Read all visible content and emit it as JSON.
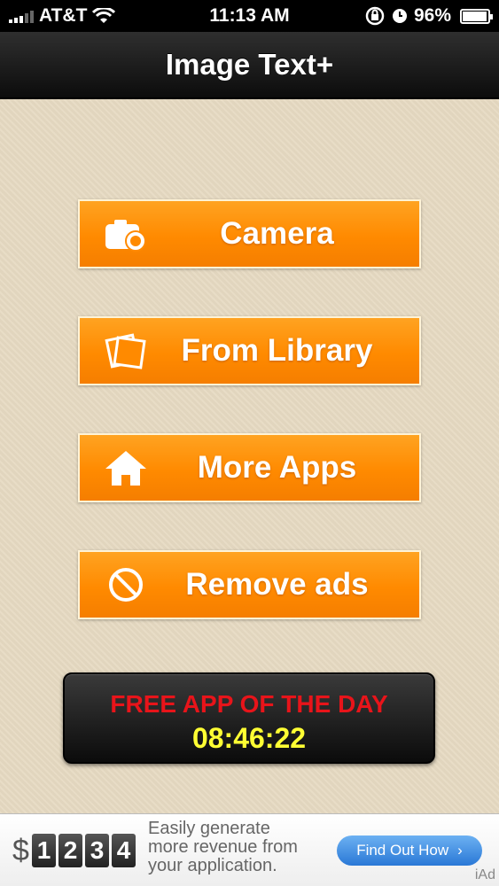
{
  "status_bar": {
    "carrier": "AT&T",
    "time": "11:13 AM",
    "battery": "96%"
  },
  "nav": {
    "title": "Image Text+"
  },
  "menu": {
    "camera": "Camera",
    "library": "From Library",
    "more_apps": "More Apps",
    "remove_ads": "Remove ads"
  },
  "free_app": {
    "title": "FREE APP OF THE DAY",
    "timer": "08:46:22"
  },
  "ad": {
    "dollar": "$",
    "digits": [
      "1",
      "2",
      "3",
      "4"
    ],
    "line1": "Easily generate",
    "line2": "more revenue from",
    "line3": "your application.",
    "cta": "Find Out How",
    "brand": "iAd"
  },
  "colors": {
    "accent": "#ff8a00",
    "background": "#e6dac2",
    "free_app_title": "#e8141a",
    "free_app_timer": "#ffff33"
  }
}
